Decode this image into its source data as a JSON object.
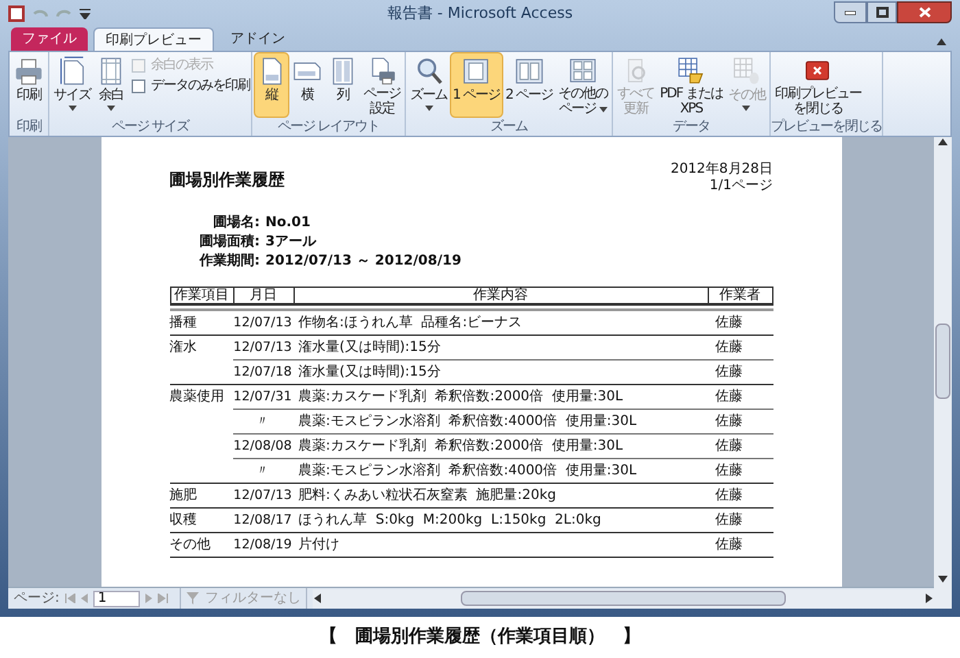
{
  "window": {
    "title": "報告書 - Microsoft Access"
  },
  "tabs": [
    {
      "label": "ファイル",
      "kind": "file",
      "selected": false
    },
    {
      "label": "印刷プレビュー",
      "kind": "tab",
      "selected": true
    },
    {
      "label": "アドイン",
      "kind": "tab",
      "selected": false
    }
  ],
  "ribbon": [
    {
      "label": "印刷",
      "items": [
        {
          "kind": "button",
          "lines": [
            "印刷"
          ],
          "selected": false,
          "disabled": false,
          "menu": false
        }
      ]
    },
    {
      "label": "ページ サイズ",
      "items": [
        {
          "kind": "button",
          "lines": [
            "サイズ"
          ],
          "selected": false,
          "disabled": false,
          "menu": true
        },
        {
          "kind": "button",
          "lines": [
            "余白"
          ],
          "selected": false,
          "disabled": false,
          "menu": true
        },
        {
          "kind": "checks",
          "checks": [
            {
              "label": "余白の表示",
              "checked": false,
              "disabled": true
            },
            {
              "label": "データのみを印刷",
              "checked": false,
              "disabled": false
            }
          ]
        }
      ]
    },
    {
      "label": "ページ レイアウト",
      "items": [
        {
          "kind": "button",
          "lines": [
            "縦"
          ],
          "selected": true,
          "disabled": false,
          "menu": false
        },
        {
          "kind": "button",
          "lines": [
            "横"
          ],
          "selected": false,
          "disabled": false,
          "menu": false
        },
        {
          "kind": "button",
          "lines": [
            "列"
          ],
          "selected": false,
          "disabled": false,
          "menu": false
        },
        {
          "kind": "button",
          "lines": [
            "ページ",
            "設定"
          ],
          "selected": false,
          "disabled": false,
          "menu": false
        }
      ]
    },
    {
      "label": "ズーム",
      "items": [
        {
          "kind": "button",
          "lines": [
            "ズーム"
          ],
          "selected": false,
          "disabled": false,
          "menu": true
        },
        {
          "kind": "button",
          "lines": [
            "1 ページ"
          ],
          "selected": true,
          "disabled": false,
          "menu": false
        },
        {
          "kind": "button",
          "lines": [
            "2 ページ"
          ],
          "selected": false,
          "disabled": false,
          "menu": false
        },
        {
          "kind": "button",
          "lines": [
            "その他の",
            "ページ"
          ],
          "selected": false,
          "disabled": false,
          "menu": true
        }
      ]
    },
    {
      "label": "データ",
      "items": [
        {
          "kind": "button",
          "lines": [
            "すべて",
            "更新"
          ],
          "selected": false,
          "disabled": true,
          "menu": false
        },
        {
          "kind": "button",
          "lines": [
            "PDF または",
            "XPS"
          ],
          "selected": false,
          "disabled": false,
          "menu": false
        },
        {
          "kind": "button",
          "lines": [
            "その他"
          ],
          "selected": false,
          "disabled": true,
          "menu": true
        }
      ]
    },
    {
      "label": "プレビューを閉じる",
      "items": [
        {
          "kind": "button",
          "lines": [
            "印刷プレビュー",
            "を閉じる"
          ],
          "selected": false,
          "disabled": false,
          "menu": false
        }
      ]
    }
  ],
  "report": {
    "title": "圃場別作業履歴",
    "date": "2012年8月28日",
    "page": "1/1ページ",
    "info": [
      {
        "label": "圃場名:",
        "value": "No.01"
      },
      {
        "label": "圃場面積:",
        "value": "3アール"
      },
      {
        "label": "作業期間:",
        "value": "2012/07/13 ～ 2012/08/19"
      }
    ],
    "columns": [
      "作業項目",
      "月日",
      "作業内容",
      "作業者"
    ],
    "groups": [
      {
        "category": "播種",
        "rows": [
          {
            "date": "12/07/13",
            "content": "作物名:ほうれん草  品種名:ビーナス",
            "worker": "佐藤"
          }
        ]
      },
      {
        "category": "潅水",
        "rows": [
          {
            "date": "12/07/13",
            "content": "潅水量(又は時間):15分",
            "worker": "佐藤"
          },
          {
            "date": "12/07/18",
            "content": "潅水量(又は時間):15分",
            "worker": "佐藤"
          }
        ]
      },
      {
        "category": "農薬使用",
        "rows": [
          {
            "date": "12/07/31",
            "content": "農薬:カスケード乳剤  希釈倍数:2000倍  使用量:30L",
            "worker": "佐藤"
          },
          {
            "date": "〃",
            "content": "農薬:モスピラン水溶剤  希釈倍数:4000倍  使用量:30L",
            "worker": "佐藤"
          },
          {
            "date": "12/08/08",
            "content": "農薬:カスケード乳剤  希釈倍数:2000倍  使用量:30L",
            "worker": "佐藤"
          },
          {
            "date": "〃",
            "content": "農薬:モスピラン水溶剤  希釈倍数:4000倍  使用量:30L",
            "worker": "佐藤"
          }
        ]
      },
      {
        "category": "施肥",
        "rows": [
          {
            "date": "12/07/13",
            "content": "肥料:くみあい粒状石灰窒素  施肥量:20kg",
            "worker": "佐藤"
          }
        ]
      },
      {
        "category": "収穫",
        "rows": [
          {
            "date": "12/08/17",
            "content": "ほうれん草  S:0kg  M:200kg  L:150kg  2L:0kg",
            "worker": "佐藤"
          }
        ]
      },
      {
        "category": "その他",
        "rows": [
          {
            "date": "12/08/19",
            "content": "片付け",
            "worker": "佐藤"
          }
        ]
      }
    ]
  },
  "navigation": {
    "label": "ページ:",
    "value": "1",
    "filter": {
      "label": "フィルターなし",
      "disabled": true
    }
  },
  "caption": "【　圃場別作業履歴（作業項目順）　】"
}
